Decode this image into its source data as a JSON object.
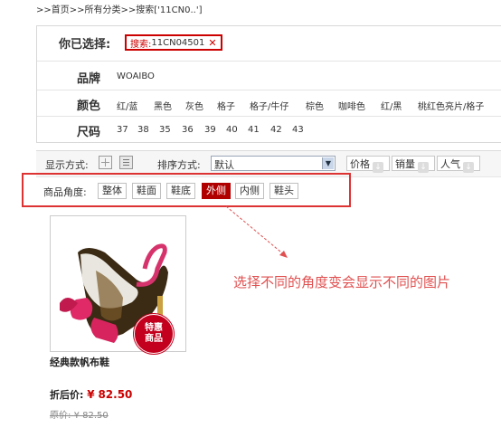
{
  "breadcrumb": ">>首页>>所有分类>>搜索['11CN0..']",
  "filters": {
    "selected_label": "你已选择:",
    "selected_key": "搜索:",
    "selected_value": "11CN04501",
    "remove_glyph": "✕",
    "brand": {
      "label": "品牌",
      "options": [
        "WOAIBO"
      ]
    },
    "color": {
      "label": "颜色",
      "options": [
        "红/蓝",
        "黑色",
        "灰色",
        "格子",
        "格子/牛仔",
        "棕色",
        "咖啡色",
        "红/黑",
        "桃红色亮片/格子"
      ]
    },
    "size": {
      "label": "尺码",
      "options": [
        "37",
        "38",
        "35",
        "36",
        "39",
        "40",
        "41",
        "42",
        "43"
      ]
    }
  },
  "sort_bar": {
    "display_label": "显示方式:",
    "sort_label": "排序方式:",
    "sort_selected": "默认",
    "buttons": [
      "价格",
      "销量",
      "人气"
    ]
  },
  "angle_bar": {
    "label": "商品角度:",
    "options": [
      "整体",
      "鞋面",
      "鞋底",
      "外侧",
      "内侧",
      "鞋头"
    ],
    "active_index": 3
  },
  "product": {
    "badge_line1": "特惠",
    "badge_line2": "商品",
    "name": "经典款帆布鞋",
    "sale_label": "折后价:",
    "currency": "¥",
    "sale_price": "82.50",
    "orig_label": "原价:",
    "orig_price": "¥ 82.50"
  },
  "annotation": "选择不同的角度变会显示不同的图片",
  "colors": {
    "accent_red": "#c00000",
    "annotation_red": "#e05050"
  }
}
